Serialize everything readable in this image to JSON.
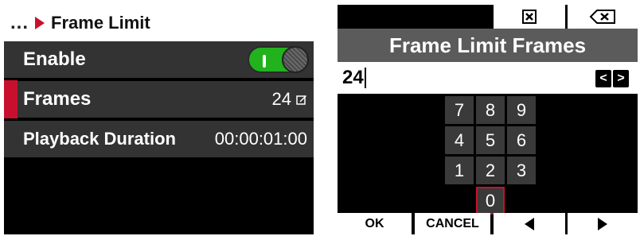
{
  "left": {
    "breadcrumb_dots": "...",
    "title": "Frame Limit",
    "rows": [
      {
        "label": "Enable",
        "toggle_on": true
      },
      {
        "label": "Frames",
        "value": "24",
        "icon": "edit-icon"
      },
      {
        "label": "Playback Duration",
        "value": "00:00:01:00"
      }
    ]
  },
  "right": {
    "top_buttons": [
      {
        "icon": "close-box-icon"
      },
      {
        "icon": "backspace-icon"
      }
    ],
    "title": "Frame Limit Frames",
    "input_value": "24",
    "cursor_buttons": {
      "left": "<",
      "right": ">"
    },
    "keypad": [
      "7",
      "8",
      "9",
      "4",
      "5",
      "6",
      "1",
      "2",
      "3",
      "0"
    ],
    "soft_buttons": {
      "ok": "OK",
      "cancel": "CANCEL",
      "prev_icon": "triangle-left-icon",
      "next_icon": "triangle-right-icon"
    }
  },
  "colors": {
    "accent_red": "#c8102e",
    "toggle_green": "#21b21e",
    "row_bg": "#333333",
    "title_bar": "#5b5b5b"
  }
}
